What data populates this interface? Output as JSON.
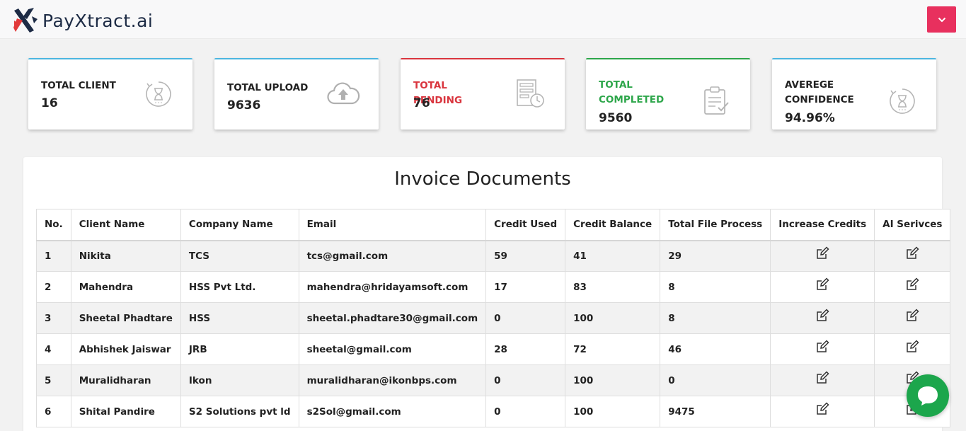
{
  "app": {
    "logo_text": "PayXtract.ai",
    "logo_icon": "x-logo-icon",
    "menu_icon": "chevron-down-icon"
  },
  "colors": {
    "accent": "#e8305e",
    "blue": "#4cb6e0",
    "red": "#d9353e",
    "green": "#2da64a",
    "chat": "#1ca64c"
  },
  "stats": [
    {
      "label": "TOTAL CLIENT",
      "value": "16",
      "icon": "hourglass-refresh-icon"
    },
    {
      "label": "TOTAL UPLOAD",
      "value": "9636",
      "icon": "cloud-upload-icon"
    },
    {
      "label": "TOTAL PENDING",
      "value": "76",
      "icon": "document-clock-icon"
    },
    {
      "label_line1": "TOTAL",
      "label_line2": "COMPLETED",
      "value": "9560",
      "icon": "clipboard-check-icon"
    },
    {
      "label_line1": "AVEREGE",
      "label_line2": "CONFIDENCE",
      "value": "94.96%",
      "icon": "hourglass-refresh-icon"
    }
  ],
  "table": {
    "title": "Invoice Documents",
    "headers": [
      "No.",
      "Client Name",
      "Company Name",
      "Email",
      "Credit Used",
      "Credit Balance",
      "Total File Process",
      "Increase Credits",
      "AI Serivces"
    ],
    "action_icon": "edit-icon",
    "rows": [
      [
        "1",
        "Nikita",
        "TCS",
        "tcs@gmail.com",
        "59",
        "41",
        "29"
      ],
      [
        "2",
        "Mahendra",
        "HSS Pvt Ltd.",
        "mahendra@hridayamsoft.com",
        "17",
        "83",
        "8"
      ],
      [
        "3",
        "Sheetal Phadtare",
        "HSS",
        "sheetal.phadtare30@gmail.com",
        "0",
        "100",
        "8"
      ],
      [
        "4",
        "Abhishek Jaiswar",
        "JRB",
        "sheetal@gmail.com",
        "28",
        "72",
        "46"
      ],
      [
        "5",
        "Muralidharan",
        "Ikon",
        "muralidharan@ikonbps.com",
        "0",
        "100",
        "0"
      ],
      [
        "6",
        "Shital Pandire",
        "S2 Solutions pvt ld",
        "s2Sol@gmail.com",
        "0",
        "100",
        "9475"
      ]
    ]
  },
  "chat": {
    "icon": "chat-bubble-icon"
  }
}
